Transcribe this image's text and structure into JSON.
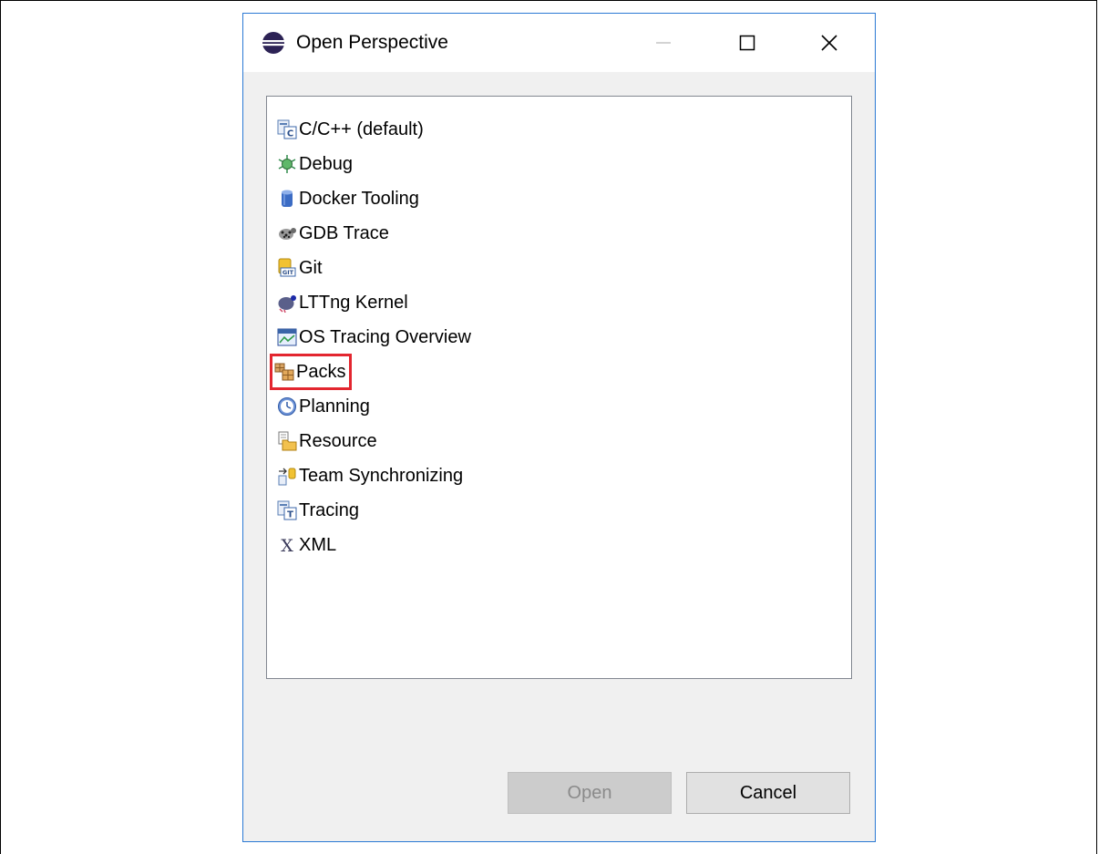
{
  "dialog": {
    "title": "Open Perspective",
    "icon": "eclipse-icon",
    "window_controls": [
      "minimize-icon",
      "maximize-icon",
      "close-icon"
    ]
  },
  "perspectives": [
    {
      "label": "C/C++ (default)",
      "icon": "cpp-perspective-icon"
    },
    {
      "label": "Debug",
      "icon": "debug-bug-icon"
    },
    {
      "label": "Docker Tooling",
      "icon": "docker-cylinder-icon"
    },
    {
      "label": "GDB Trace",
      "icon": "gdb-trace-icon"
    },
    {
      "label": "Git",
      "icon": "git-icon"
    },
    {
      "label": "LTTng Kernel",
      "icon": "lttng-kernel-icon"
    },
    {
      "label": "OS Tracing Overview",
      "icon": "os-tracing-icon"
    },
    {
      "label": "Packs",
      "icon": "packs-icon",
      "highlighted": true
    },
    {
      "label": "Planning",
      "icon": "planning-clock-icon"
    },
    {
      "label": "Resource",
      "icon": "resource-folder-icon"
    },
    {
      "label": "Team Synchronizing",
      "icon": "team-sync-icon"
    },
    {
      "label": "Tracing",
      "icon": "tracing-icon"
    },
    {
      "label": "XML",
      "icon": "xml-icon"
    }
  ],
  "buttons": {
    "open_label": "Open",
    "open_enabled": false,
    "cancel_label": "Cancel"
  },
  "colors": {
    "highlight_border": "#e3262f",
    "dialog_border": "#2b79d4"
  }
}
